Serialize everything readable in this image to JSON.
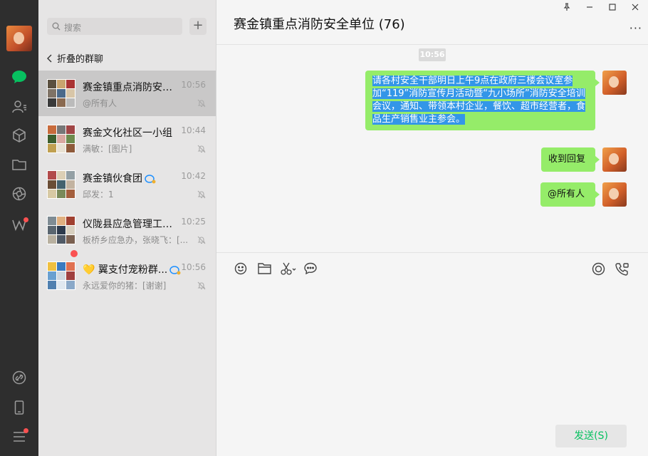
{
  "search": {
    "placeholder": "搜索"
  },
  "folded": {
    "label": "折叠的群聊"
  },
  "chats": [
    {
      "name": "赛金镇重点消防安全单位 (76)",
      "time": "10:56",
      "last": "@所有人",
      "colors": [
        "#5a4f3f",
        "#c9a46e",
        "#a33",
        "#7f7366",
        "#4b6a8a",
        "#d8c6a8",
        "#3a3a3a",
        "#8a6a50",
        "#bbb"
      ]
    },
    {
      "name": "赛金文化社区一小组",
      "time": "10:44",
      "last": "满敏：[图片]",
      "colors": [
        "#c86b3c",
        "#777",
        "#a04545",
        "#3e5f2e",
        "#d9a8a0",
        "#6d8b4d",
        "#c0a050",
        "#e8e1d2",
        "#8e5a3a"
      ]
    },
    {
      "name": "赛金镇伙食团",
      "time": "10:42",
      "last": "邱发：1",
      "colors": [
        "#b24a4a",
        "#dccfb5",
        "#94a0a5",
        "#6a4e36",
        "#45626e",
        "#c3b3a0",
        "#d7c9a4",
        "#7a8a5a",
        "#a45f3d"
      ]
    },
    {
      "name": "仪陇县应急管理工作群",
      "time": "10:25",
      "last": "板桥乡应急办，张晓飞：[...",
      "colors": [
        "#7f8c94",
        "#e0b080",
        "#a04030",
        "#5a6670",
        "#2d3a4c",
        "#d8d0c0",
        "#b8b0a0",
        "#505a66",
        "#7a6050"
      ]
    },
    {
      "name": "💛 翼支付宠粉群...",
      "time": "10:56",
      "last": "永远爱你的猪：[谢谢]",
      "colors": [
        "#f0c040",
        "#3a7ac0",
        "#e07050",
        "#6aa0d0",
        "#d0d8e0",
        "#a04040",
        "#5080b0",
        "#e0e8f0",
        "#8aa8c8"
      ]
    }
  ],
  "header": {
    "title": "赛金镇重点消防安全单位 (76)"
  },
  "messages": {
    "time": "10:56",
    "m1": "请各村安全干部明日上午9点在政府三楼会议室参加“119”消防宣传月活动暨“九小场所”消防安全培训会议，通知、带领本村企业，餐饮、超市经营者，食品生产销售业主参会。",
    "m2": "收到回复",
    "m3": "@所有人"
  },
  "send": {
    "label": "发送(S)"
  },
  "colors": {
    "accent": "#07c160",
    "bubble": "#95ec69",
    "selection": "#3396e8",
    "badge": "#fa5151"
  }
}
